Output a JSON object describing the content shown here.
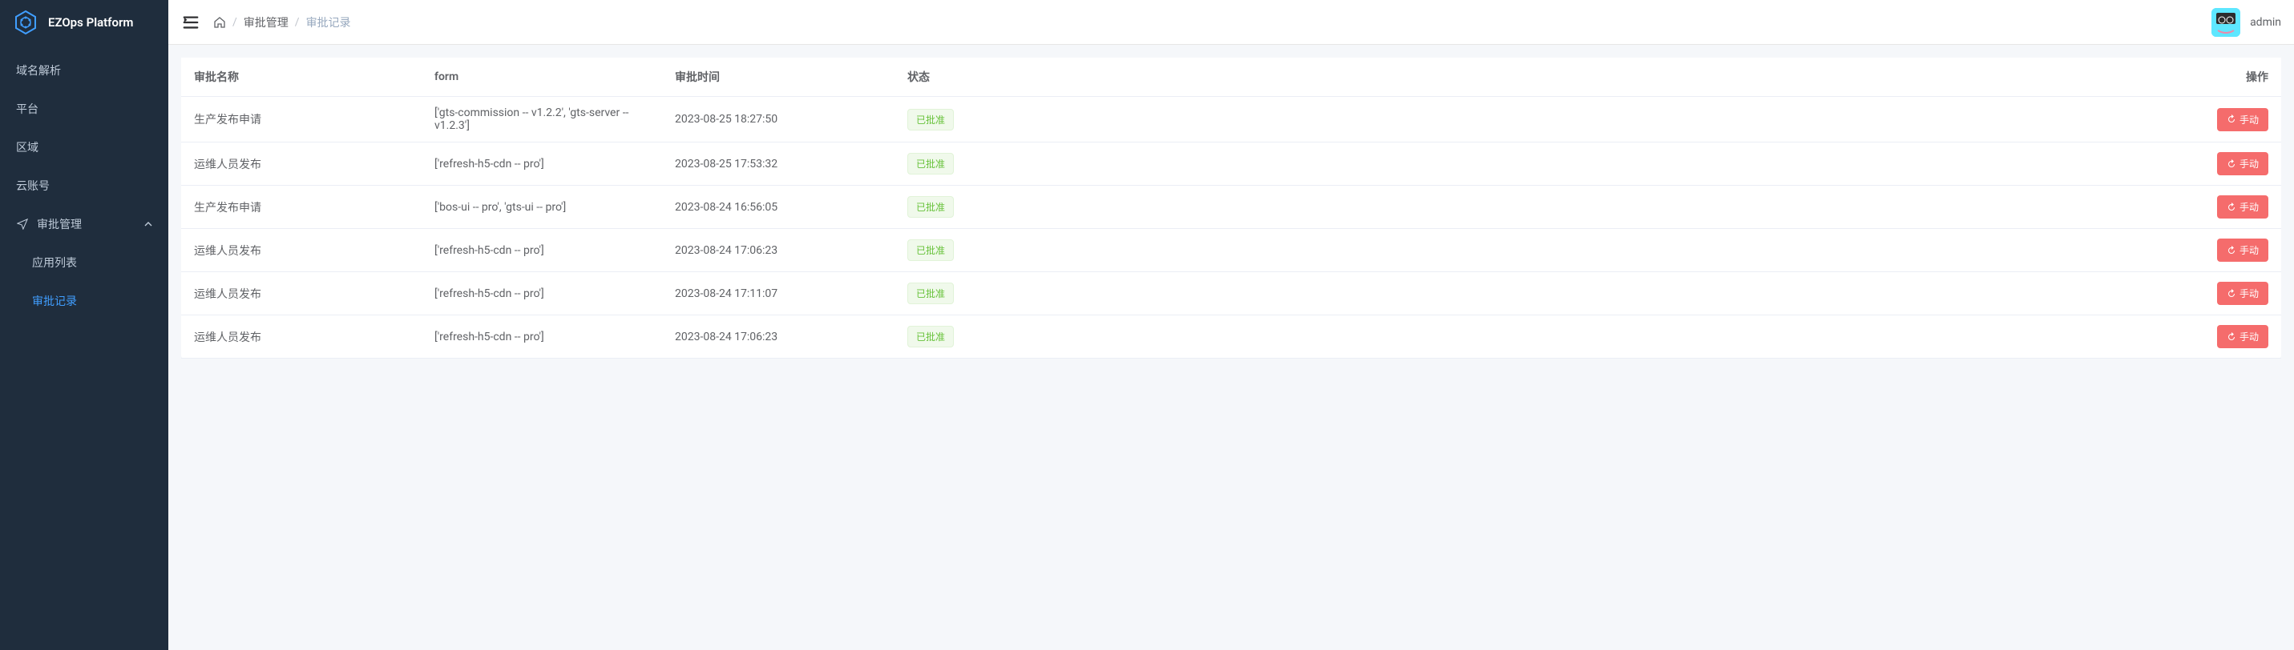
{
  "brand": {
    "name": "EZOps Platform"
  },
  "sidebar": {
    "items": [
      {
        "label": "域名解析"
      },
      {
        "label": "平台"
      },
      {
        "label": "区域"
      },
      {
        "label": "云账号"
      }
    ],
    "group": {
      "label": "审批管理"
    },
    "subitems": [
      {
        "label": "应用列表"
      },
      {
        "label": "审批记录"
      }
    ]
  },
  "breadcrumb": {
    "items": [
      {
        "label": "审批管理"
      },
      {
        "label": "审批记录"
      }
    ]
  },
  "user": {
    "name": "admin"
  },
  "table": {
    "headers": {
      "name": "审批名称",
      "form": "form",
      "time": "审批时间",
      "status": "状态",
      "action": "操作"
    },
    "rows": [
      {
        "name": "生产发布申请",
        "form": "['gts-commission -- v1.2.2', 'gts-server -- v1.2.3']",
        "time": "2023-08-25 18:27:50",
        "status": "已批准",
        "action": "手动"
      },
      {
        "name": "运维人员发布",
        "form": "['refresh-h5-cdn -- pro']",
        "time": "2023-08-25 17:53:32",
        "status": "已批准",
        "action": "手动"
      },
      {
        "name": "生产发布申请",
        "form": "['bos-ui -- pro', 'gts-ui -- pro']",
        "time": "2023-08-24 16:56:05",
        "status": "已批准",
        "action": "手动"
      },
      {
        "name": "运维人员发布",
        "form": "['refresh-h5-cdn -- pro']",
        "time": "2023-08-24 17:06:23",
        "status": "已批准",
        "action": "手动"
      },
      {
        "name": "运维人员发布",
        "form": "['refresh-h5-cdn -- pro']",
        "time": "2023-08-24 17:11:07",
        "status": "已批准",
        "action": "手动"
      },
      {
        "name": "运维人员发布",
        "form": "['refresh-h5-cdn -- pro']",
        "time": "2023-08-24 17:06:23",
        "status": "已批准",
        "action": "手动"
      }
    ]
  }
}
